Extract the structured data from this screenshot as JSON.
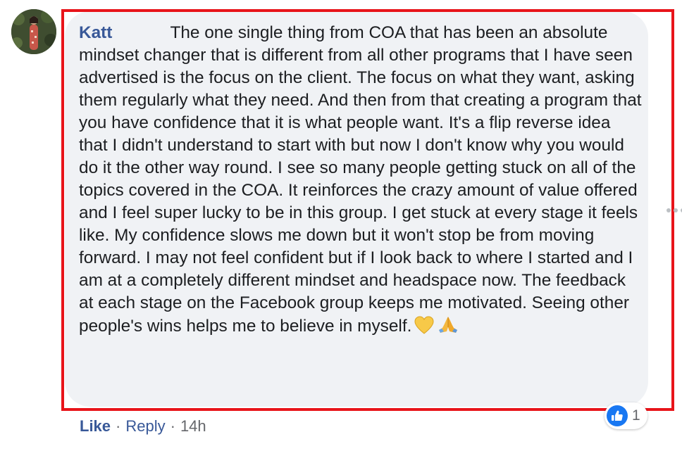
{
  "comment": {
    "author": "Katt",
    "text": "The one single thing from COA that has been an absolute mindset changer that is different from all other programs that I have seen advertised is the focus on the client. The focus on what they want, asking them regularly what they need. And then from that creating a program that you have confidence that it is what people want. It's a flip reverse idea that I didn't understand to start with but now I don't know why you would do it the other way round. I see so many people getting stuck on all of the topics covered in the COA. It reinforces the crazy amount of value offered and I feel super lucky to be in this group. I get stuck at every stage it feels like. My confidence slows me down but it won't stop be from moving forward. I may not feel confident but if I look back to where I started and I am at a completely different mindset and headspace now. The feedback at each stage on the Facebook group keeps me motivated. Seeing other people's wins helps me to believe in myself.",
    "emojis": [
      "yellow-heart-icon",
      "folded-hands-icon"
    ]
  },
  "actions": {
    "like_label": "Like",
    "reply_label": "Reply",
    "separator": "·",
    "timestamp": "14h"
  },
  "reactions": {
    "icon": "thumbs-up-icon",
    "count": "1"
  },
  "colors": {
    "bubble": "#f0f2f5",
    "author": "#385898",
    "highlight_border": "#e8141a",
    "like_badge": "#1877f2"
  }
}
